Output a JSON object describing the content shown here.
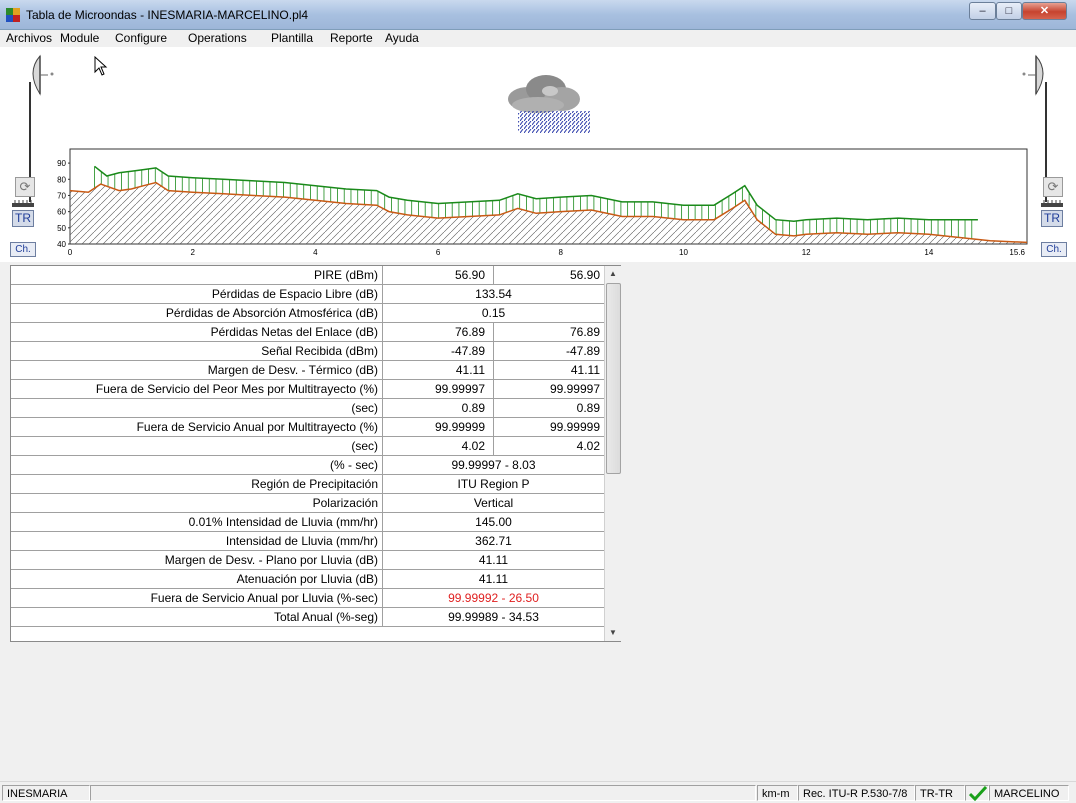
{
  "window": {
    "title": "Tabla de Microondas - INESMARIA-MARCELINO.pl4",
    "minimize_glyph": "–",
    "maximize_glyph": "□",
    "close_glyph": "✕"
  },
  "menu": [
    "Archivos",
    "Module",
    "Configure",
    "Operations",
    "Plantilla",
    "Reporte",
    "Ayuda"
  ],
  "left_site": {
    "tr_label": "TR",
    "ch_label": "Ch."
  },
  "right_site": {
    "tr_label": "TR",
    "ch_label": "Ch."
  },
  "chart_data": {
    "type": "line",
    "y_ticks": [
      "90",
      "80",
      "70",
      "60",
      "50",
      "40"
    ],
    "ylim": [
      40,
      95
    ],
    "x_ticks": [
      "0",
      "2",
      "4",
      "6",
      "8",
      "10",
      "12",
      "14",
      "15.6"
    ],
    "xlim": [
      0,
      15.6
    ],
    "series": [
      {
        "color": "#c85a14",
        "x": [
          0,
          0.3,
          0.5,
          0.8,
          1.0,
          1.2,
          1.4,
          1.6,
          2.0,
          2.5,
          3.0,
          3.5,
          4.0,
          4.5,
          5.0,
          5.2,
          5.5,
          6.0,
          6.5,
          7.0,
          7.3,
          7.6,
          8.0,
          8.5,
          9.0,
          9.5,
          10.0,
          10.5,
          10.8,
          11.0,
          11.2,
          11.5,
          11.8,
          12.0,
          12.5,
          13.0,
          13.5,
          14.0,
          14.5,
          15.0,
          15.6
        ],
        "y": [
          73,
          72,
          77,
          73,
          74,
          76,
          78,
          73,
          72,
          71,
          70,
          69,
          67,
          65,
          64,
          60,
          58,
          56,
          57,
          58,
          62,
          59,
          60,
          61,
          57,
          57,
          55,
          55,
          62,
          67,
          55,
          46,
          45,
          46,
          47,
          46,
          47,
          46,
          44,
          42,
          41
        ]
      },
      {
        "color": "#1a8a1a",
        "x": [
          0.4,
          0.6,
          0.8,
          1.0,
          1.2,
          1.4,
          1.6,
          2.0,
          2.5,
          3.0,
          3.5,
          4.0,
          4.5,
          5.0,
          5.2,
          5.5,
          6.0,
          6.5,
          7.0,
          7.3,
          7.6,
          8.0,
          8.5,
          9.0,
          9.5,
          10.0,
          10.5,
          10.8,
          11.0,
          11.2,
          11.5,
          11.8,
          12.0,
          12.5,
          13.0,
          13.5,
          14.0,
          14.5,
          14.8
        ],
        "y": [
          88,
          82,
          84,
          85,
          86,
          87,
          82,
          81,
          80,
          79,
          78,
          76,
          74,
          73,
          69,
          67,
          65,
          66,
          67,
          71,
          68,
          69,
          70,
          66,
          66,
          64,
          64,
          71,
          76,
          64,
          55,
          54,
          55,
          56,
          55,
          56,
          55,
          55,
          55
        ]
      }
    ]
  },
  "results": {
    "rows": [
      {
        "label": "PIRE (dBm)",
        "v1": "56.90",
        "v2": "56.90"
      },
      {
        "label": "Pérdidas de Espacio Libre (dB)",
        "span": "133.54"
      },
      {
        "label": "Pérdidas de Absorción Atmosférica (dB)",
        "span": "0.15"
      },
      {
        "label": "Pérdidas Netas del Enlace (dB)",
        "v1": "76.89",
        "v2": "76.89"
      },
      {
        "label": "Señal Recibida (dBm)",
        "v1": "-47.89",
        "v2": "-47.89"
      },
      {
        "label": "Margen de Desv. - Térmico (dB)",
        "v1": "41.11",
        "v2": "41.11"
      },
      {
        "label": "Fuera de Servicio del Peor Mes por Multitrayecto (%)",
        "v1": "99.99997",
        "v2": "99.99997"
      },
      {
        "label": "(sec)",
        "v1": "0.89",
        "v2": "0.89"
      },
      {
        "label": "Fuera de Servicio Anual por Multitrayecto (%)",
        "v1": "99.99999",
        "v2": "99.99999"
      },
      {
        "label": "(sec)",
        "v1": "4.02",
        "v2": "4.02"
      },
      {
        "label": "(% - sec)",
        "span": "99.99997 - 8.03"
      },
      {
        "label": "Región de Precipitación",
        "span": "ITU Region P"
      },
      {
        "label": "Polarización",
        "span": "Vertical"
      },
      {
        "label": "0.01% Intensidad de Lluvia (mm/hr)",
        "span": "145.00"
      },
      {
        "label": "Intensidad de Lluvia (mm/hr)",
        "span": "362.71"
      },
      {
        "label": "Margen de Desv. - Plano por Lluvia (dB)",
        "span": "41.11"
      },
      {
        "label": "Atenuación por Lluvia (dB)",
        "span": "41.11"
      },
      {
        "label": "Fuera de Servicio Anual por Lluvia (%-sec)",
        "span": "99.99992 - 26.50",
        "highlight": "#e02020"
      },
      {
        "label": "Total Anual (%-seg)",
        "span": "99.99989 - 34.53"
      }
    ],
    "scroll_position": 0
  },
  "status": {
    "left": "INESMARIA",
    "units": "km-m",
    "method": "Rec. ITU-R P.530-7/8",
    "mode": "TR-TR",
    "check_icon": "check-icon",
    "right": "MARCELINO"
  }
}
